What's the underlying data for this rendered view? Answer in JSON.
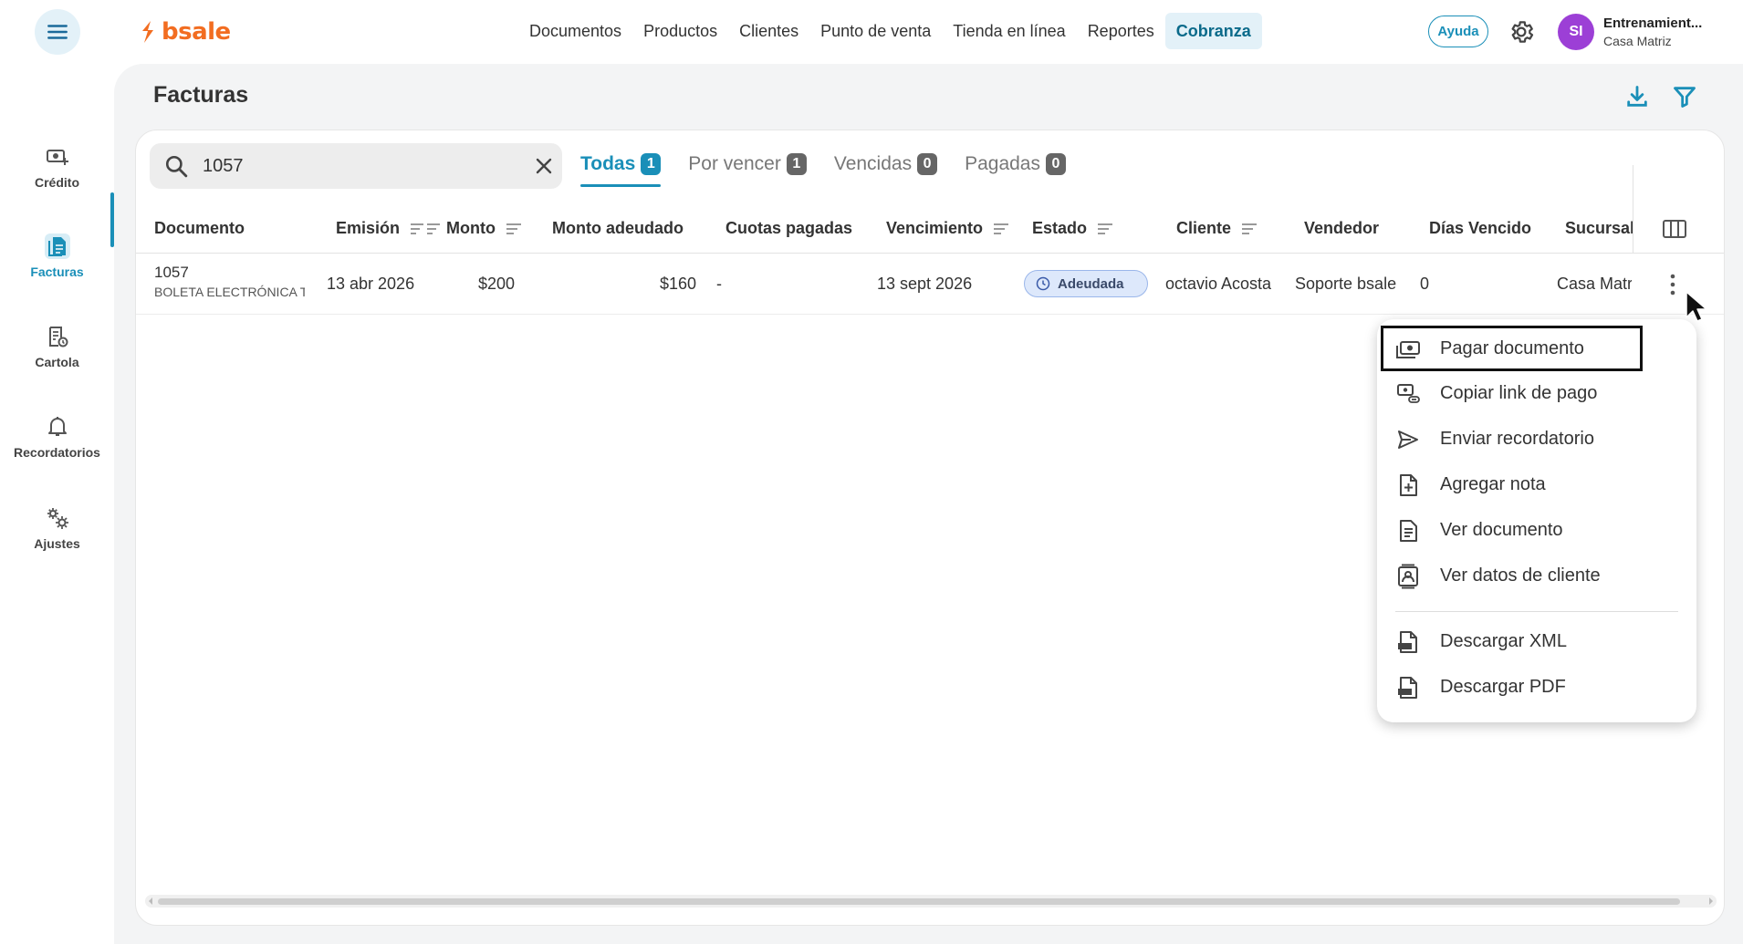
{
  "topbar": {
    "brand": "bsale",
    "nav": [
      {
        "label": "Documentos"
      },
      {
        "label": "Productos"
      },
      {
        "label": "Clientes"
      },
      {
        "label": "Punto de venta"
      },
      {
        "label": "Tienda en línea"
      },
      {
        "label": "Reportes"
      },
      {
        "label": "Cobranza",
        "active": true
      }
    ],
    "help_label": "Ayuda",
    "user": {
      "initials": "SI",
      "name": "Entrenamient...",
      "branch": "Casa Matriz"
    }
  },
  "sidebar": {
    "items": [
      {
        "label": "Crédito"
      },
      {
        "label": "Facturas",
        "active": true
      },
      {
        "label": "Cartola"
      },
      {
        "label": "Recordatorios"
      },
      {
        "label": "Ajustes"
      }
    ]
  },
  "page": {
    "title": "Facturas"
  },
  "search": {
    "value": "1057"
  },
  "tabs": [
    {
      "label": "Todas",
      "count": "1",
      "active": true
    },
    {
      "label": "Por vencer",
      "count": "1"
    },
    {
      "label": "Vencidas",
      "count": "0"
    },
    {
      "label": "Pagadas",
      "count": "0"
    }
  ],
  "table": {
    "columns": [
      "Documento",
      "Emisión",
      "Monto",
      "Monto adeudado",
      "Cuotas pagadas",
      "Vencimiento",
      "Estado",
      "Cliente",
      "Vendedor",
      "Días Vencido",
      "Sucursal"
    ],
    "rows": [
      {
        "number": "1057",
        "type": "BOLETA ELECTRÓNICA T",
        "emision": "13 abr 2026",
        "monto": "$200",
        "adeudado": "$160",
        "cuotas": "-",
        "vencimiento": "13 sept 2026",
        "estado": "Adeudada",
        "cliente": "octavio Acosta",
        "vendedor": "Soporte bsale",
        "dias": "0",
        "sucursal": "Casa Matriz"
      }
    ]
  },
  "menu": {
    "items": [
      {
        "label": "Pagar documento",
        "icon": "money-icon"
      },
      {
        "label": "Copiar link de pago",
        "icon": "link-money-icon"
      },
      {
        "label": "Enviar recordatorio",
        "icon": "send-icon"
      },
      {
        "label": "Agregar nota",
        "icon": "add-note-icon"
      },
      {
        "label": "Ver documento",
        "icon": "document-icon"
      },
      {
        "label": "Ver datos de cliente",
        "icon": "contact-card-icon"
      },
      {
        "label": "Descargar XML",
        "icon": "xml-file-icon"
      },
      {
        "label": "Descargar PDF",
        "icon": "pdf-file-icon"
      }
    ]
  },
  "colors": {
    "accent": "#1a8fb8",
    "brand": "#f26d21",
    "avatar": "#9c3fd6"
  }
}
